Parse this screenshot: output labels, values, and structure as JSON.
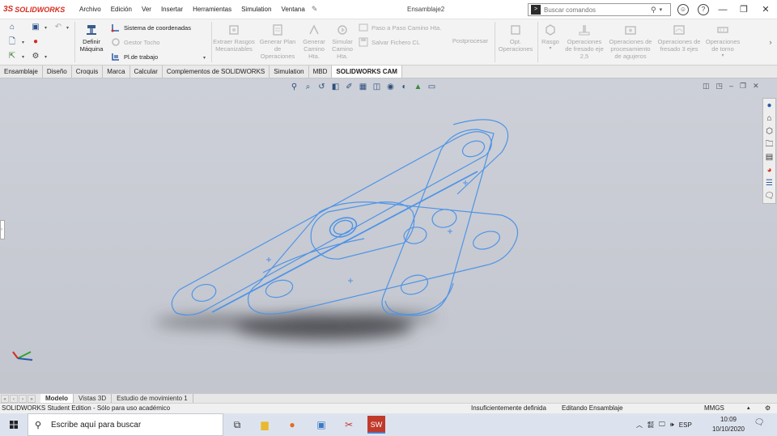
{
  "app": {
    "brand": "SOLIDWORKS",
    "document_title": "Ensamblaje2"
  },
  "menu": [
    "Archivo",
    "Edición",
    "Ver",
    "Insertar",
    "Herramientas",
    "Simulation",
    "Ventana"
  ],
  "search": {
    "placeholder": "Buscar comandos"
  },
  "cam_toolbar": {
    "definir_maquina": "Definir Máquina",
    "sistema_coordenadas": "Sistema de coordenadas",
    "gestor_tocho": "Gestor Tocho",
    "pl_trabajo": "Pl.de trabajo",
    "extraer_rasgos": "Extraer Rasgos Mecanizables",
    "generar_plan": "Generar Plan de Operaciones",
    "generar_camino": "Generar Camino Hta.",
    "simular_camino": "Simular Camino Hta.",
    "paso_a_paso": "Paso a Paso Camino Hta.",
    "salvar_fichero": "Salvar Fichero CL",
    "postprocesar": "Postprocesar",
    "opt_operaciones": "Opt. Operaciones",
    "rasgo": "Rasgo",
    "op_fresado_25": "Operaciones de fresado eje 2,5",
    "op_agujeros": "Operaciones de procesamiento de agujeros",
    "op_fresado_3": "Operaciones de fresado 3 ejes",
    "op_torno": "Operaciones de torno"
  },
  "tabs": [
    {
      "label": "Ensamblaje"
    },
    {
      "label": "Diseño"
    },
    {
      "label": "Croquis"
    },
    {
      "label": "Marca"
    },
    {
      "label": "Calcular"
    },
    {
      "label": "Complementos de SOLIDWORKS"
    },
    {
      "label": "Simulation"
    },
    {
      "label": "MBD"
    },
    {
      "label": "SOLIDWORKS CAM"
    }
  ],
  "active_tab": "SOLIDWORKS CAM",
  "bottom_tabs": [
    {
      "label": "Modelo"
    },
    {
      "label": "Vistas 3D"
    },
    {
      "label": "Estudio de movimiento 1"
    }
  ],
  "status": {
    "edition": "SOLIDWORKS Student Edition - Sólo para uso académico",
    "definition": "Insuficientemente definida",
    "mode": "Editando Ensamblaje",
    "units": "MMGS"
  },
  "taskbar": {
    "search_placeholder": "Escribe aquí para buscar",
    "language": "ESP",
    "time": "10:09",
    "date": "10/10/2020"
  },
  "colors": {
    "brand_red": "#d52b1e",
    "model_edge_blue": "#4f94e6",
    "viewport_bg": "#c9ccd4"
  }
}
